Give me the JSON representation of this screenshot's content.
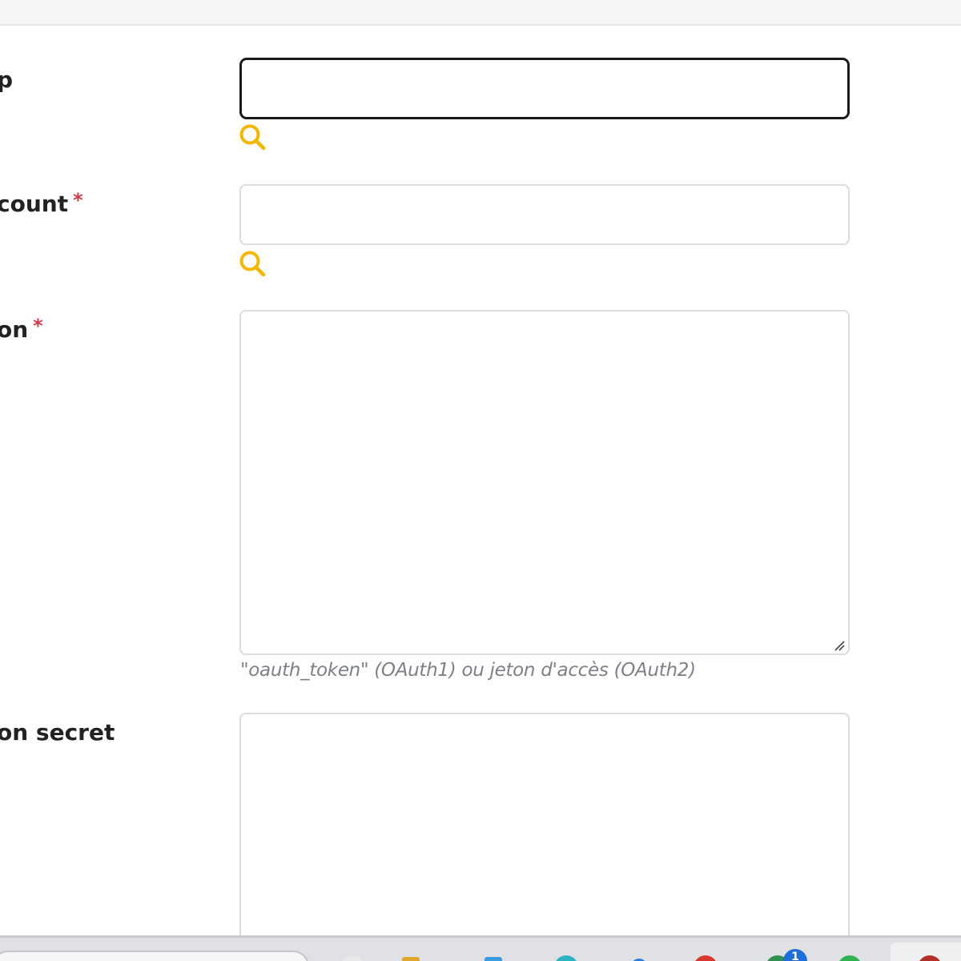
{
  "form": {
    "fields": [
      {
        "label": "p",
        "required": false,
        "value": "",
        "icon": "search-icon"
      },
      {
        "label": "count",
        "required": true,
        "value": "",
        "icon": "search-icon"
      },
      {
        "label": "on",
        "required": true,
        "value": "",
        "help": "\"oauth_token\" (OAuth1) ou jeton d'accès (OAuth2)"
      },
      {
        "label": "on secret",
        "required": false,
        "value": ""
      }
    ],
    "required_mark": "*"
  },
  "taskbar": {
    "notification_badge": "1"
  },
  "colors": {
    "accent_icon": "#f2b701",
    "required": "#d03a4a",
    "focus_border": "#1a1a1a",
    "help_text": "#7d8187"
  }
}
